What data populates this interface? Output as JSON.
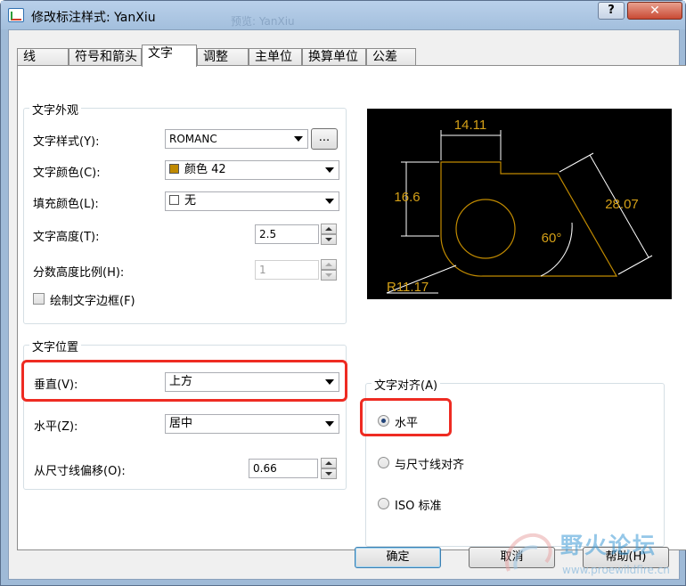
{
  "window": {
    "title": "修改标注样式: YanXiu",
    "title_shadow": "预览: YanXiu",
    "help_button": "?",
    "close_button": "✕"
  },
  "tabs": [
    "线",
    "符号和箭头",
    "文字",
    "调整",
    "主单位",
    "换算单位",
    "公差"
  ],
  "active_tab": "文字",
  "text_appearance": {
    "group_title": "文字外观",
    "style_label": "文字样式(Y):",
    "style_value": "ROMANC",
    "style_browse": "...",
    "color_label": "文字颜色(C):",
    "color_value": "颜色 42",
    "color_swatch": "#c08a00",
    "fill_label": "填充颜色(L):",
    "fill_value": "无",
    "height_label": "文字高度(T):",
    "height_value": "2.5",
    "fraction_label": "分数高度比例(H):",
    "fraction_value": "1",
    "frame_label": "绘制文字边框(F)",
    "frame_checked": false
  },
  "text_placement": {
    "group_title": "文字位置",
    "vertical_label": "垂直(V):",
    "vertical_value": "上方",
    "horizontal_label": "水平(Z):",
    "horizontal_value": "居中",
    "offset_label": "从尺寸线偏移(O):",
    "offset_value": "0.66"
  },
  "text_alignment": {
    "group_title": "文字对齐(A)",
    "options": [
      "水平",
      "与尺寸线对齐",
      "ISO 标准"
    ],
    "selected": "水平"
  },
  "preview": {
    "dim_top": "14.11",
    "dim_left": "16.6",
    "dim_right": "28.07",
    "dim_angle": "60°",
    "dim_radius": "R11.17",
    "line_color": "#c08a00",
    "text_color": "#d4a017"
  },
  "buttons": {
    "ok": "确定",
    "cancel": "取消",
    "help": "帮助(H)"
  },
  "watermark": {
    "text": "野火论坛",
    "url": "www.proewildfire.cn"
  },
  "colors": {
    "highlight": "#ee2b22",
    "title_bar": "#a3bfdd"
  }
}
